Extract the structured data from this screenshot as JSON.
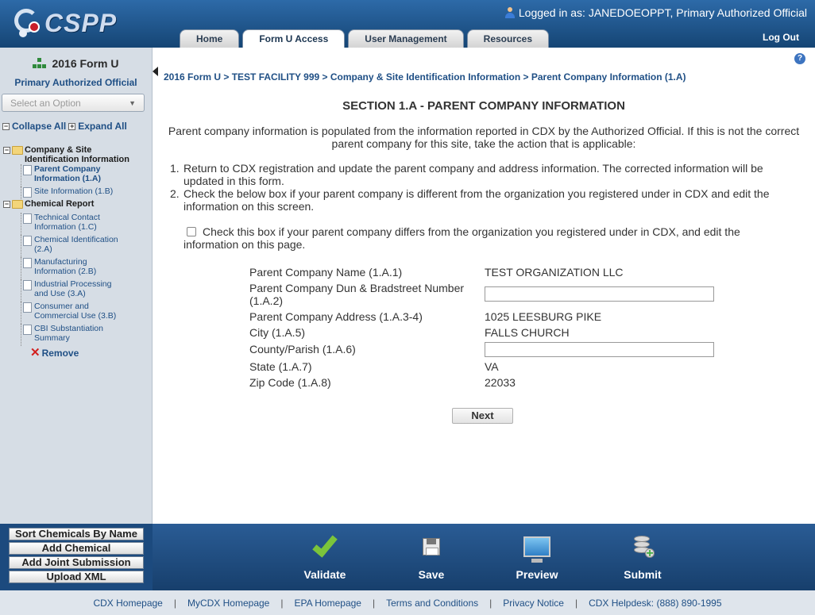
{
  "header": {
    "logo_text": "CSPP",
    "logged_in": "Logged in as: JANEDOEOPPT, Primary Authorized Official",
    "tabs": [
      {
        "label": "Home"
      },
      {
        "label": "Form U Access"
      },
      {
        "label": "User Management"
      },
      {
        "label": "Resources"
      }
    ],
    "logout": "Log Out"
  },
  "sidebar": {
    "title": "2016 Form U",
    "role": "Primary Authorized Official",
    "select_placeholder": "Select an Option",
    "collapse_all": "Collapse All",
    "expand_all": "Expand All",
    "tree": {
      "group1": "Company & Site Identification Information",
      "group1_items": [
        "Parent Company Information (1.A)",
        "Site Information (1.B)"
      ],
      "group2": "Chemical Report",
      "group2_items": [
        "Technical Contact Information (1.C)",
        "Chemical Identification (2.A)",
        "Manufacturing Information (2.B)",
        "Industrial Processing and Use (3.A)",
        "Consumer and Commercial Use (3.B)",
        "CBI Substantiation Summary"
      ],
      "remove": "Remove"
    },
    "buttons": [
      "Sort Chemicals By Name",
      "Add Chemical",
      "Add Joint Submission",
      "Upload XML"
    ]
  },
  "main": {
    "breadcrumb": "2016 Form U > TEST FACILITY 999 > Company & Site Identification Information > Parent Company Information (1.A)",
    "title": "SECTION 1.A - PARENT COMPANY INFORMATION",
    "intro": "Parent company information is populated from the information reported in CDX by the Authorized Official. If this is not the correct parent company for this site, take the action that is applicable:",
    "steps": [
      {
        "n": "1.",
        "text": "Return to CDX registration and update the parent company and address information. The corrected information will be updated in this form."
      },
      {
        "n": "2.",
        "text": "Check the below box if your parent company is different from the organization you registered under in CDX and edit the information on this screen."
      }
    ],
    "checkbox_label": "Check this box if your parent company differs from the organization you registered under in CDX, and edit the information on this page.",
    "fields": {
      "name_label": "Parent Company Name (1.A.1)",
      "name_value": "TEST ORGANIZATION LLC",
      "duns_label": "Parent Company Dun & Bradstreet Number (1.A.2)",
      "duns_value": "",
      "address_label": "Parent Company Address (1.A.3-4)",
      "address_value": "1025 LEESBURG PIKE",
      "city_label": "City (1.A.5)",
      "city_value": "FALLS CHURCH",
      "county_label": "County/Parish (1.A.6)",
      "county_value": "",
      "state_label": "State (1.A.7)",
      "state_value": "VA",
      "zip_label": "Zip Code (1.A.8)",
      "zip_value": "22033"
    },
    "next": "Next"
  },
  "actions": {
    "validate": "Validate",
    "save": "Save",
    "preview": "Preview",
    "submit": "Submit"
  },
  "footer": {
    "links": [
      "CDX Homepage",
      "MyCDX Homepage",
      "EPA Homepage",
      "Terms and Conditions",
      "Privacy Notice",
      "CDX Helpdesk: (888) 890-1995"
    ]
  },
  "colors": {
    "header_blue": "#1b4f86",
    "link_blue": "#1f4f85",
    "sidebar_bg": "#d6dde5",
    "validate_green": "#7bc43b"
  }
}
